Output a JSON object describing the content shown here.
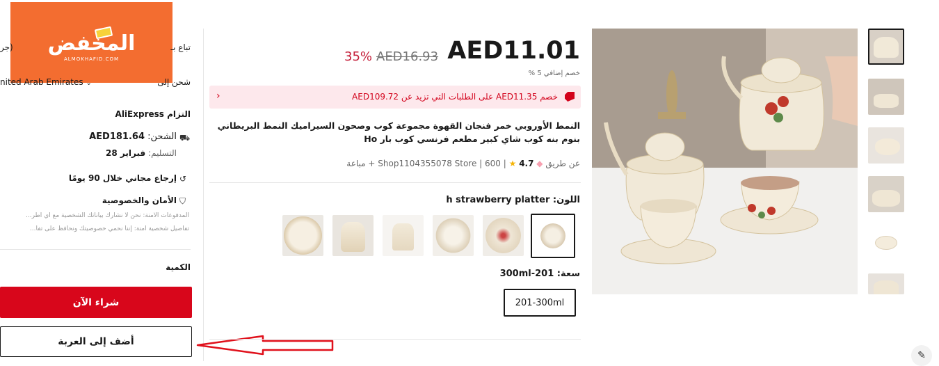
{
  "logo": {
    "name": "المخفض",
    "sub": "ALMOKHAFID.COM"
  },
  "panel": {
    "sold_by": "تباع بـ",
    "sold_by_extra": "(جر",
    "ship_to_label": "شحن إلى",
    "ship_to_value": "nited Arab Emirates",
    "commitment_label": "التزام",
    "commitment_brand": "AliExpress",
    "shipping_label": "الشحن:",
    "shipping_value": "AED181.64",
    "delivery_label": "التسليم:",
    "delivery_value": "فبراير 28",
    "free_return": "إرجاع مجاني خلال 90 يومًا",
    "security_title": "الأمان والخصوصية",
    "security_line1": "المدفوعات الآمنة: نحن لا نشارك بياناتك الشخصية مع أي أطر...",
    "security_line2": "تفاصيل شخصية آمنة: إننا نحمي خصوصيتك ونحافظ على تفا...",
    "quantity_label": "الكمية",
    "buy_now": "شراء الآن",
    "add_to_cart": "أضف إلى العربة"
  },
  "product": {
    "price": "AED11.01",
    "old_price": "AED16.93",
    "discount": "35%",
    "extra_discount": "خصم إضافي 5 %",
    "coupon_text": "خصم AED11.35 على الطلبات التي تزيد عن AED109.72",
    "title": "النمط الأوروبي خمر فنجان القهوة مجموعة كوب وصحون السيراميك النمط البريطاني بنوم بنه كوب شاي كبير مطعم فرنسي كوب بار Ho",
    "store_prefix": "عن طريق",
    "store_name": "Shop1104355078 Store",
    "sold_count": "600",
    "rating": "4.7",
    "sales_suffix": "+ مباعة",
    "color_label": "اللون:",
    "color_value": "h strawberry platter",
    "capacity_label": "سعة:",
    "capacity_value": "201-300ml",
    "capacity_option": "201-300ml"
  },
  "colors": {
    "accent_red": "#d8061b",
    "coupon_bg": "#fde8ec",
    "logo_orange": "#f36d30"
  },
  "icons": {
    "chevron": "›",
    "edit": "✎"
  }
}
